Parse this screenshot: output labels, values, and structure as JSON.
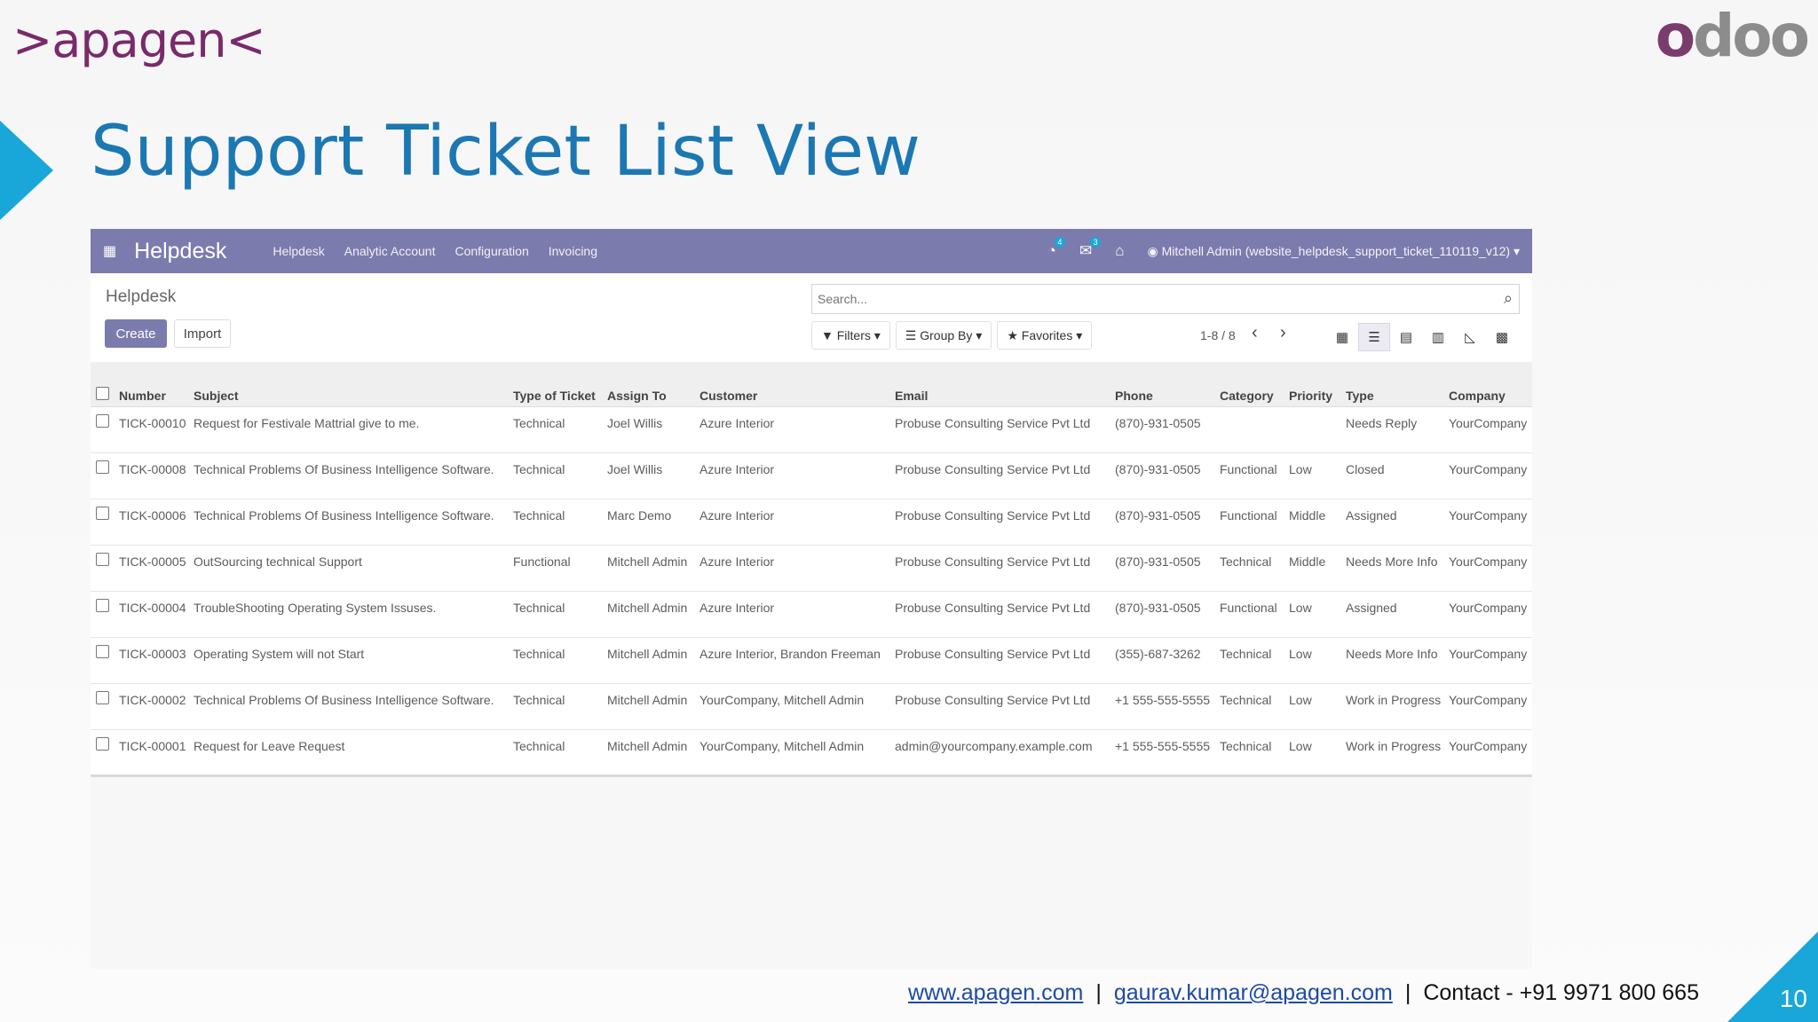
{
  "slide": {
    "brand_left": ">apagen<",
    "brand_right_o": "o",
    "brand_right_rest": "doo",
    "title": "Support Ticket List View",
    "footer": {
      "website": "www.apagen.com",
      "email": "gaurav.kumar@apagen.com",
      "contact": "Contact - +91 9971 800 665"
    },
    "page_number": "10",
    "accent_color": "#19a7d9"
  },
  "app": {
    "navbar": {
      "apps_icon": "grid-icon",
      "app_name": "Helpdesk",
      "menu": [
        "Helpdesk",
        "Analytic Account",
        "Configuration",
        "Invoicing"
      ],
      "activity_badge": "4",
      "messages_badge": "3",
      "user": "Mitchell Admin (website_helpdesk_support_ticket_110119_v12)",
      "color": "#7c7bad"
    },
    "control_panel": {
      "breadcrumb": "Helpdesk",
      "create_label": "Create",
      "import_label": "Import",
      "search_placeholder": "Search...",
      "filters_label": "Filters",
      "group_by_label": "Group By",
      "favorites_label": "Favorites",
      "pager": "1-8 / 8"
    },
    "table": {
      "headers": {
        "number": "Number",
        "subject": "Subject",
        "type_of_ticket": "Type of Ticket",
        "assign_to": "Assign To",
        "customer": "Customer",
        "email": "Email",
        "phone": "Phone",
        "category": "Category",
        "priority": "Priority",
        "type": "Type",
        "company": "Company"
      },
      "rows": [
        {
          "number": "TICK-00010",
          "subject": "Request for Festivale Mattrial give to me.",
          "type_of_ticket": "Technical",
          "assign_to": "Joel Willis",
          "customer": "Azure Interior",
          "email": "Probuse Consulting Service Pvt Ltd",
          "phone": "(870)-931-0505",
          "category": "",
          "priority": "",
          "type": "Needs Reply",
          "company": "YourCompany"
        },
        {
          "number": "TICK-00008",
          "subject": "Technical Problems Of Business Intelligence Software.",
          "type_of_ticket": "Technical",
          "assign_to": "Joel Willis",
          "customer": "Azure Interior",
          "email": "Probuse Consulting Service Pvt Ltd",
          "phone": "(870)-931-0505",
          "category": "Functional",
          "priority": "Low",
          "type": "Closed",
          "company": "YourCompany"
        },
        {
          "number": "TICK-00006",
          "subject": "Technical Problems Of Business Intelligence Software.",
          "type_of_ticket": "Technical",
          "assign_to": "Marc Demo",
          "customer": "Azure Interior",
          "email": "Probuse Consulting Service Pvt Ltd",
          "phone": "(870)-931-0505",
          "category": "Functional",
          "priority": "Middle",
          "type": "Assigned",
          "company": "YourCompany"
        },
        {
          "number": "TICK-00005",
          "subject": "OutSourcing technical Support",
          "type_of_ticket": "Functional",
          "assign_to": "Mitchell Admin",
          "customer": "Azure Interior",
          "email": "Probuse Consulting Service Pvt Ltd",
          "phone": "(870)-931-0505",
          "category": "Technical",
          "priority": "Middle",
          "type": "Needs More Info",
          "company": "YourCompany"
        },
        {
          "number": "TICK-00004",
          "subject": "TroubleShooting Operating System Issuses.",
          "type_of_ticket": "Technical",
          "assign_to": "Mitchell Admin",
          "customer": "Azure Interior",
          "email": "Probuse Consulting Service Pvt Ltd",
          "phone": "(870)-931-0505",
          "category": "Functional",
          "priority": "Low",
          "type": "Assigned",
          "company": "YourCompany"
        },
        {
          "number": "TICK-00003",
          "subject": "Operating System will not Start",
          "type_of_ticket": "Technical",
          "assign_to": "Mitchell Admin",
          "customer": "Azure Interior, Brandon Freeman",
          "email": "Probuse Consulting Service Pvt Ltd",
          "phone": "(355)-687-3262",
          "category": "Technical",
          "priority": "Low",
          "type": "Needs More Info",
          "company": "YourCompany"
        },
        {
          "number": "TICK-00002",
          "subject": "Technical Problems Of Business Intelligence Software.",
          "type_of_ticket": "Technical",
          "assign_to": "Mitchell Admin",
          "customer": "YourCompany, Mitchell Admin",
          "email": "Probuse Consulting Service Pvt Ltd",
          "phone": "+1 555-555-5555",
          "category": "Technical",
          "priority": "Low",
          "type": "Work in Progress",
          "company": "YourCompany"
        },
        {
          "number": "TICK-00001",
          "subject": "Request for Leave Request",
          "type_of_ticket": "Technical",
          "assign_to": "Mitchell Admin",
          "customer": "YourCompany, Mitchell Admin",
          "email": "admin@yourcompany.example.com",
          "phone": "+1 555-555-5555",
          "category": "Technical",
          "priority": "Low",
          "type": "Work in Progress",
          "company": "YourCompany"
        }
      ]
    }
  }
}
